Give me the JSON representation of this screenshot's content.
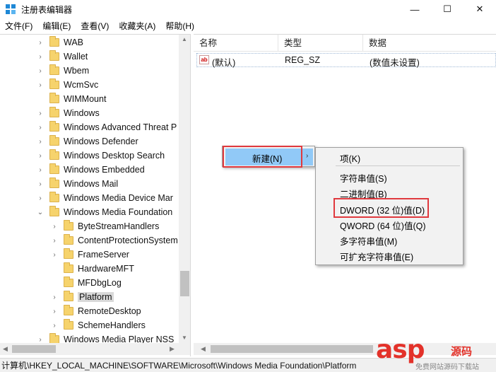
{
  "window": {
    "title": "注册表编辑器",
    "minimize": "—",
    "maximize": "☐",
    "close": "✕"
  },
  "menubar": [
    "文件(F)",
    "编辑(E)",
    "查看(V)",
    "收藏夹(A)",
    "帮助(H)"
  ],
  "tree": {
    "items": [
      {
        "label": "WAB"
      },
      {
        "label": "Wallet"
      },
      {
        "label": "Wbem"
      },
      {
        "label": "WcmSvc"
      },
      {
        "label": "WIMMount"
      },
      {
        "label": "Windows"
      },
      {
        "label": "Windows Advanced Threat P"
      },
      {
        "label": "Windows Defender"
      },
      {
        "label": "Windows Desktop Search"
      },
      {
        "label": "Windows Embedded"
      },
      {
        "label": "Windows Mail"
      },
      {
        "label": "Windows Media Device Mar"
      },
      {
        "label": "Windows Media Foundation"
      },
      {
        "label": "ByteStreamHandlers"
      },
      {
        "label": "ContentProtectionSystem"
      },
      {
        "label": "FrameServer"
      },
      {
        "label": "HardwareMFT"
      },
      {
        "label": "MFDbgLog"
      },
      {
        "label": "Platform"
      },
      {
        "label": "RemoteDesktop"
      },
      {
        "label": "SchemeHandlers"
      },
      {
        "label": "Windows Media Player NSS"
      }
    ]
  },
  "values": {
    "columns": [
      "名称",
      "类型",
      "数据"
    ],
    "rows": [
      {
        "icon": "string-value-icon",
        "icon_text": "ab",
        "name": "(默认)",
        "type": "REG_SZ",
        "data": "(数值未设置)"
      }
    ]
  },
  "context_menu": {
    "new_label": "新建(N)",
    "arrow": "›"
  },
  "submenu": {
    "items": [
      "项(K)",
      "字符串值(S)",
      "二进制值(B)",
      "DWORD (32 位)值(D)",
      "QWORD (64 位)值(Q)",
      "多字符串值(M)",
      "可扩充字符串值(E)"
    ]
  },
  "status": {
    "path": "计算机\\HKEY_LOCAL_MACHINE\\SOFTWARE\\Microsoft\\Windows Media Foundation\\Platform"
  },
  "watermark": {
    "logo": "asp",
    "cn": "源码",
    "sub": "免费网站源码下载站"
  },
  "colors": {
    "highlight": "#91c9f7",
    "annotation_red": "#e0393e",
    "folder": "#f6d36c"
  }
}
